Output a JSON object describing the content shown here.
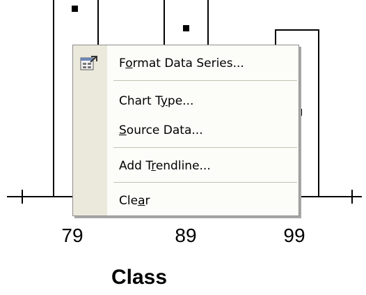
{
  "chart": {
    "x_axis": {
      "title": "Class",
      "tick_labels": [
        "79",
        "89",
        "99"
      ]
    },
    "colors": {
      "bars": "#000000",
      "markers": "#000000"
    }
  },
  "context_menu": {
    "items": [
      {
        "label": "Format Data Series...",
        "mnemonic": "o",
        "icon": "format-data-series-icon"
      },
      {
        "label": "Chart Type...",
        "mnemonic": "y"
      },
      {
        "label": "Source Data...",
        "mnemonic": "S"
      },
      {
        "label": "Add Trendline...",
        "mnemonic": "r"
      },
      {
        "label": "Clear",
        "mnemonic": "a"
      }
    ]
  }
}
